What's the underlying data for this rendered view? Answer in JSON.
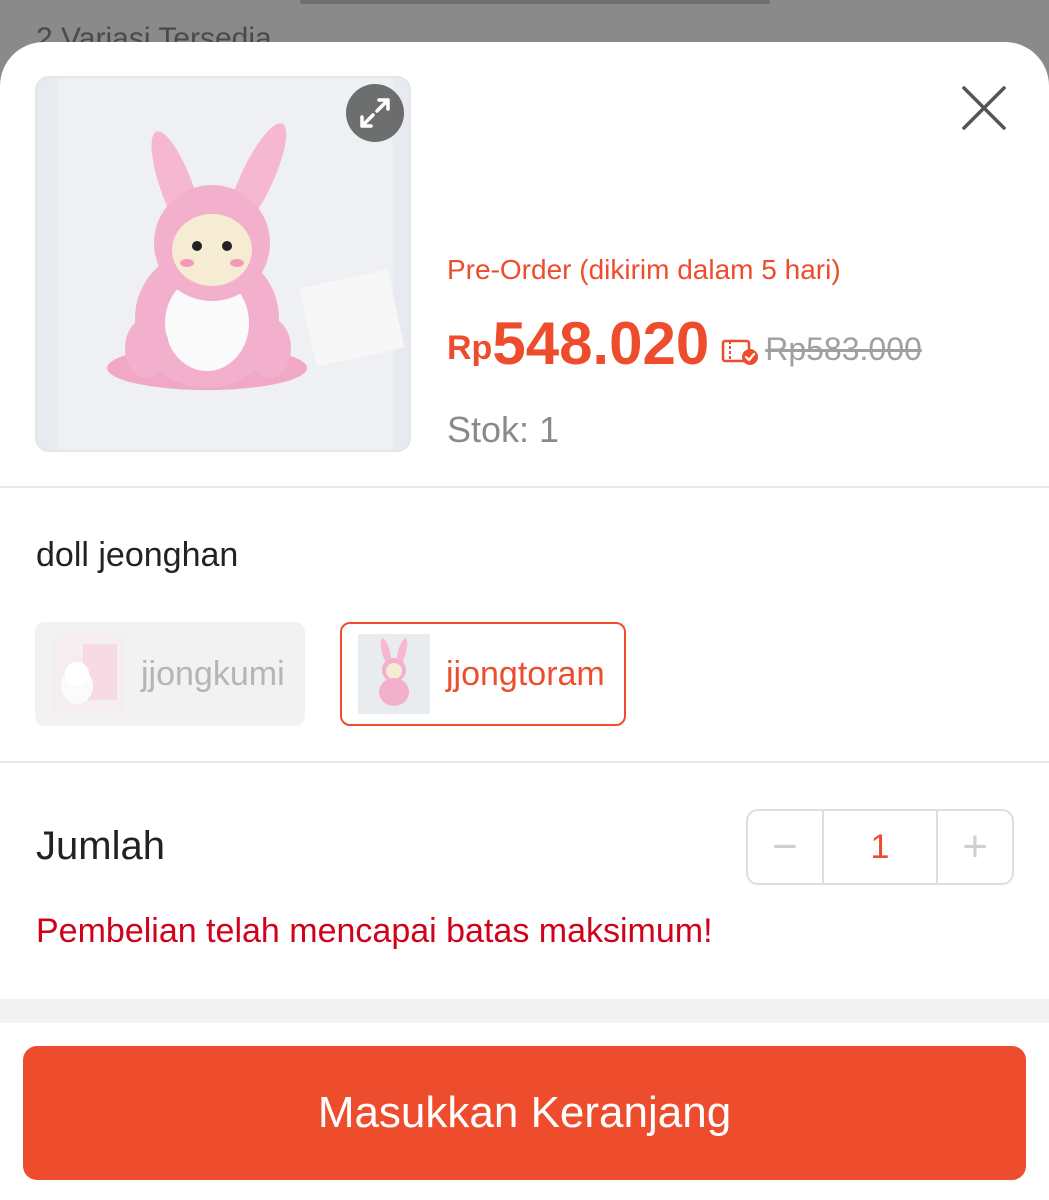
{
  "backdrop": {
    "variants_text": "2 Variasi Tersedia"
  },
  "product": {
    "preorder_text": "Pre-Order (dikirim dalam 5 hari)",
    "price_currency": "Rp",
    "price_value": "548.020",
    "original_price": "Rp583.000",
    "stock_text": "Stok: 1"
  },
  "variation": {
    "label": "doll jeonghan",
    "options": [
      {
        "label": "jjongkumi",
        "state": "disabled"
      },
      {
        "label": "jjongtoram",
        "state": "selected"
      }
    ]
  },
  "quantity": {
    "label": "Jumlah",
    "value": "1",
    "minus_symbol": "−",
    "plus_symbol": "+",
    "warning": "Pembelian telah mencapai batas maksimum!"
  },
  "cta": {
    "label": "Masukkan Keranjang"
  },
  "icons": {
    "expand": "expand-icon",
    "close": "close-icon",
    "voucher": "voucher-icon"
  },
  "colors": {
    "accent": "#ee4d2d",
    "warning": "#d0011b",
    "muted": "#a0a0a0"
  }
}
